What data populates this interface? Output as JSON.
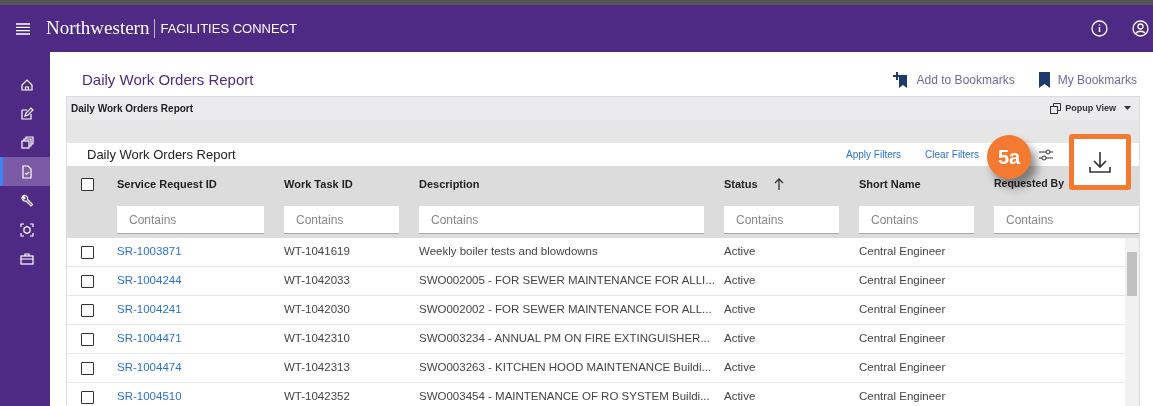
{
  "app": {
    "brand": "Northwestern",
    "product": "FACILITIES CONNECT"
  },
  "sidebar": {
    "items": [
      {
        "kind": "home",
        "selected": false
      },
      {
        "kind": "edit",
        "selected": false
      },
      {
        "kind": "copy",
        "selected": false
      },
      {
        "kind": "report",
        "selected": true
      },
      {
        "kind": "wrench",
        "selected": false
      },
      {
        "kind": "scan",
        "selected": false
      },
      {
        "kind": "briefcase",
        "selected": false
      }
    ]
  },
  "page": {
    "title": "Daily Work Orders Report",
    "actions": [
      {
        "kind": "add",
        "label": "Add to Bookmarks"
      },
      {
        "kind": "list",
        "label": "My Bookmarks"
      }
    ]
  },
  "panel": {
    "title": "Daily Work Orders Report",
    "popup": "Popup View"
  },
  "grid": {
    "title": "Daily Work Orders Report",
    "toolbar": [
      "Apply Filters",
      "Clear Filters"
    ],
    "select_all_checked": false,
    "columns": [
      {
        "label": "Service Request ID",
        "sorted": false,
        "placeholder": "Contains"
      },
      {
        "label": "Work Task ID",
        "sorted": false,
        "placeholder": "Contains"
      },
      {
        "label": "Description",
        "sorted": false,
        "placeholder": "Contains"
      },
      {
        "label": "Status",
        "sorted": true,
        "placeholder": "Contains"
      },
      {
        "label": "Short Name",
        "sorted": false,
        "placeholder": "Contains"
      },
      {
        "label": "Requested By",
        "sorted": false,
        "placeholder": "Contains"
      }
    ],
    "rows": [
      {
        "checked": false,
        "cells": [
          "SR-1003871",
          "WT-1041619",
          "Weekly boiler tests and blowdowns",
          "Active",
          "Central Engineer"
        ]
      },
      {
        "checked": false,
        "cells": [
          "SR-1004244",
          "WT-1042033",
          "SWO002005 - FOR SEWER MAINTENANCE FOR ALLI...",
          "Active",
          "Central Engineer"
        ]
      },
      {
        "checked": false,
        "cells": [
          "SR-1004241",
          "WT-1042030",
          "SWO002002 - FOR SEWER MAINTENANCE FOR ALL...",
          "Active",
          "Central Engineer"
        ]
      },
      {
        "checked": false,
        "cells": [
          "SR-1004471",
          "WT-1042310",
          "SWO003234 - ANNUAL PM ON FIRE EXTINGUISHER...",
          "Active",
          "Central Engineer"
        ]
      },
      {
        "checked": false,
        "cells": [
          "SR-1004474",
          "WT-1042313",
          "SWO003263 - KITCHEN HOOD MAINTENANCE Buildi...",
          "Active",
          "Central Engineer"
        ]
      },
      {
        "checked": false,
        "cells": [
          "SR-1004510",
          "WT-1042352",
          "SWO003454 - MAINTENANCE OF RO SYSTEM Buildi...",
          "Active",
          "Central Engineer"
        ]
      }
    ]
  },
  "callout": {
    "label": "5a"
  }
}
